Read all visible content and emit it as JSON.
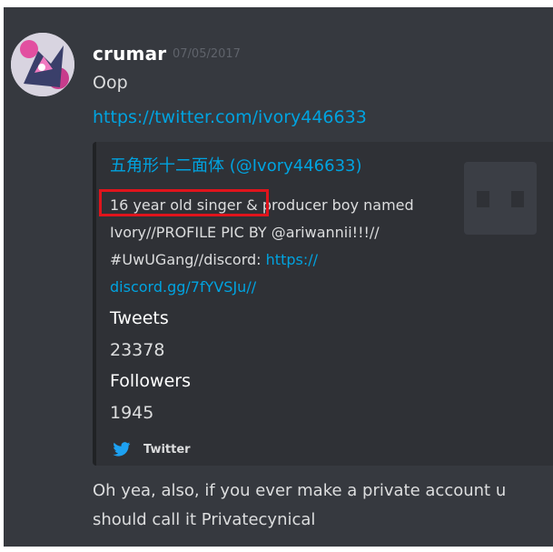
{
  "message": {
    "username": "crumar",
    "timestamp": "07/05/2017",
    "text": "Oop",
    "link": "https://twitter.com/ivory446633",
    "followup_line1": "Oh yea, also, if you ever make a private account u",
    "followup_line2": "should call it Privatecynical"
  },
  "embed": {
    "title": "五角形十二面体 (@Ivory446633)",
    "description_line1_highlighted": "16 year old singer &",
    "description_line1_rest": "producer boy named",
    "description_line2": "Ivory//PROFILE PIC BY @ariwannii!!!//",
    "description_line3_text": "#UwUGang//discord: ",
    "description_line3_link": "https://",
    "description_line4_link": "discord.gg/7fYVSJu//",
    "fields": [
      {
        "name": "Tweets",
        "value": "23378"
      },
      {
        "name": "Followers",
        "value": "1945"
      }
    ],
    "footer": "Twitter",
    "icons": {
      "footer_icon": "twitter-bird-icon",
      "thumbnail": "thumbnail-placeholder-icon"
    }
  },
  "colors": {
    "background": "#36393f",
    "embed_background": "#2f3136",
    "link": "#00a3e0",
    "highlight": "#e0141c",
    "twitter_blue": "#1da1f2"
  }
}
